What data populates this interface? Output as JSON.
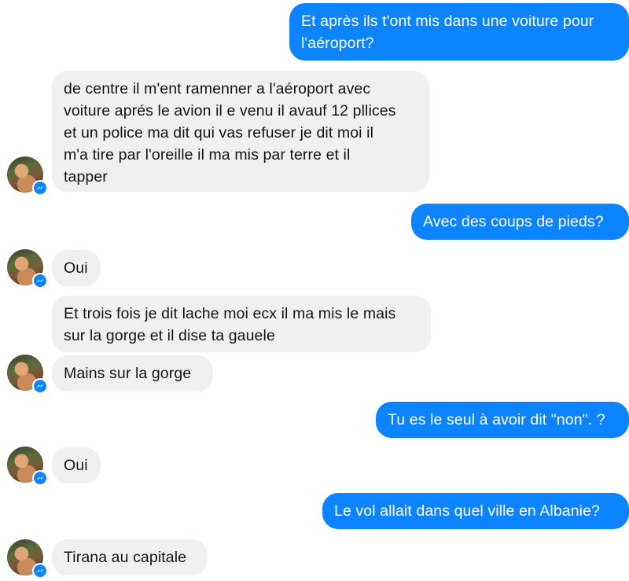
{
  "messages": [
    {
      "direction": "out",
      "text": "Et après ils t'ont mis dans une voiture pour\nl'aéroport?"
    },
    {
      "direction": "in",
      "text": "de centre il m'ent ramenner a l'aéroport avec\nvoiture aprés le avion il e venu il avauf 12 pllices\net un police ma dit qui vas refuser je dit moi il\nm'a tire par l'oreille il ma mis par terre et il\ntapper"
    },
    {
      "direction": "out",
      "text": "Avec des coups de pieds?"
    },
    {
      "direction": "in",
      "text": "Oui"
    },
    {
      "direction": "in",
      "text": "Et trois fois je dit lache moi ecx il ma mis le mais\nsur la gorge et il dise ta gauele"
    },
    {
      "direction": "in",
      "text": "Mains sur la gorge"
    },
    {
      "direction": "out",
      "text": "Tu es le seul à avoir dit \"non\". ?"
    },
    {
      "direction": "in",
      "text": "Oui"
    },
    {
      "direction": "out",
      "text": "Le vol allait dans quel ville en Albanie?"
    },
    {
      "direction": "in",
      "text": "Tirana au capitale"
    }
  ],
  "colors": {
    "outgoing_bubble": "#0d84ff",
    "incoming_bubble": "#f0f0f0",
    "outgoing_text": "#ffffff",
    "incoming_text": "#141414"
  },
  "icons": {
    "avatar_badge": "messenger-icon"
  }
}
